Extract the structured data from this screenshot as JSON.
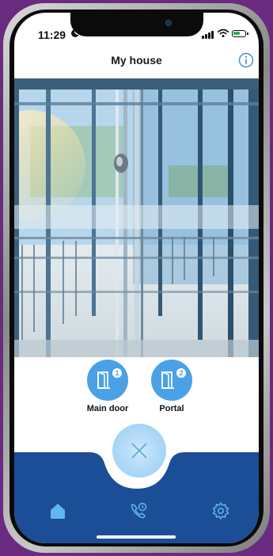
{
  "status_bar": {
    "time": "11:29"
  },
  "header": {
    "title": "My house"
  },
  "doors": [
    {
      "label": "Main door",
      "badge": "1"
    },
    {
      "label": "Portal",
      "badge": "2"
    }
  ],
  "colors": {
    "accent": "#4aa1e6",
    "nav_background": "#1b4e96",
    "hangup": "#aad6f7",
    "background": "#6a2a80"
  },
  "icons": {
    "info": "info-icon",
    "door": "door-icon",
    "close": "close-icon",
    "home": "home-icon",
    "call_history": "phone-clock-icon",
    "settings": "gear-icon"
  }
}
